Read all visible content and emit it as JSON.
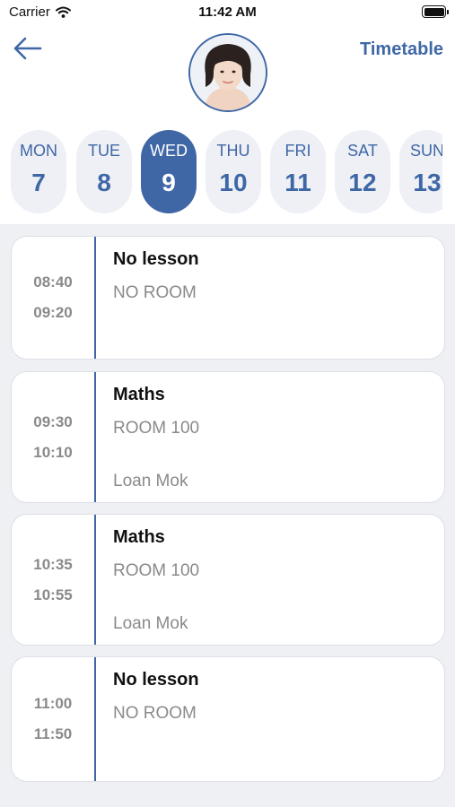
{
  "status_bar": {
    "carrier": "Carrier",
    "time": "11:42 AM"
  },
  "nav": {
    "title": "Timetable"
  },
  "days": [
    {
      "name": "MON",
      "num": "7",
      "selected": false
    },
    {
      "name": "TUE",
      "num": "8",
      "selected": false
    },
    {
      "name": "WED",
      "num": "9",
      "selected": true
    },
    {
      "name": "THU",
      "num": "10",
      "selected": false
    },
    {
      "name": "FRI",
      "num": "11",
      "selected": false
    },
    {
      "name": "SAT",
      "num": "12",
      "selected": false
    },
    {
      "name": "SUN",
      "num": "13",
      "selected": false
    }
  ],
  "lessons": [
    {
      "start": "08:40",
      "end": "09:20",
      "subject": "No lesson",
      "room": "NO ROOM",
      "teacher": ""
    },
    {
      "start": "09:30",
      "end": "10:10",
      "subject": "Maths",
      "room": "ROOM 100",
      "teacher": "Loan Mok"
    },
    {
      "start": "10:35",
      "end": "10:55",
      "subject": "Maths",
      "room": "ROOM 100",
      "teacher": "Loan Mok"
    },
    {
      "start": "11:00",
      "end": "11:50",
      "subject": "No lesson",
      "room": "NO ROOM",
      "teacher": ""
    }
  ],
  "colors": {
    "accent": "#3f67a6",
    "day_bg": "#eef0f5",
    "list_bg": "#eef0f4",
    "muted_text": "#8a8a8a"
  },
  "icons": {
    "back": "arrow-left-icon",
    "wifi": "wifi-icon",
    "battery": "battery-icon"
  }
}
